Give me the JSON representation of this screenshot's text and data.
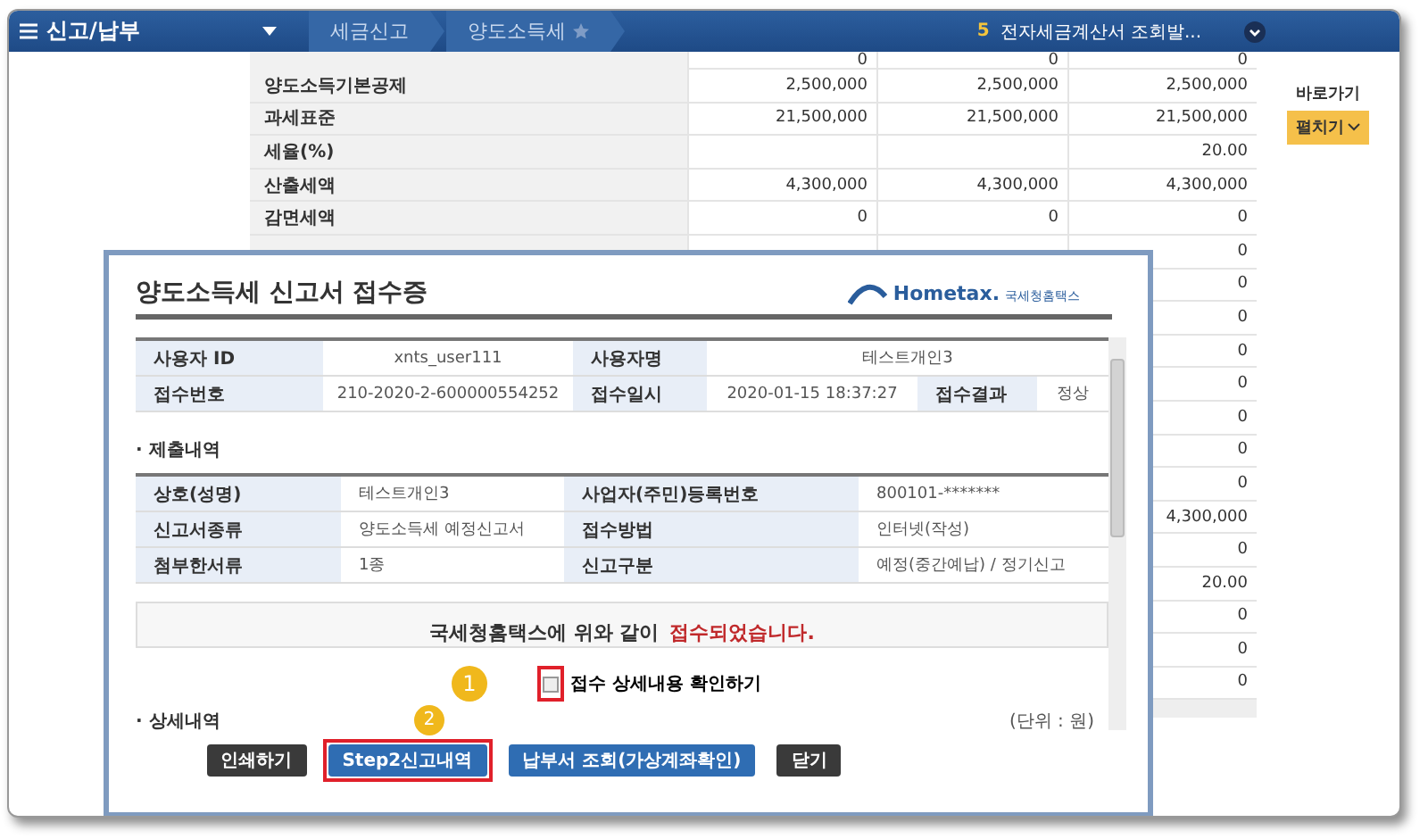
{
  "top_bar": {
    "menu_title": "신고/납부",
    "breadcrumbs": [
      {
        "label": "세금신고",
        "starred": false
      },
      {
        "label": "양도소득세",
        "starred": true
      }
    ],
    "notice_count": "5",
    "notice_text": "전자세금계산서 조회발..."
  },
  "page_table": {
    "rows": [
      {
        "values": [
          "0",
          "0",
          "0"
        ]
      },
      {
        "label": "양도소득기본공제",
        "values": [
          "2,500,000",
          "2,500,000",
          "2,500,000"
        ]
      },
      {
        "label": "과세표준",
        "values": [
          "21,500,000",
          "21,500,000",
          "21,500,000"
        ]
      },
      {
        "label": "세율(%)",
        "last_value": "20.00"
      },
      {
        "label": "산출세액",
        "values": [
          "4,300,000",
          "4,300,000",
          "4,300,000"
        ]
      },
      {
        "label": "감면세액",
        "values": [
          "0",
          "0",
          "0"
        ]
      },
      {
        "last_value": "0"
      },
      {
        "last_value": "0"
      },
      {
        "last_value": "0"
      },
      {
        "last_value": "0"
      },
      {
        "last_value": "0"
      },
      {
        "last_value": "0"
      },
      {
        "last_value": "0"
      },
      {
        "last_value": "0"
      },
      {
        "last_value": "4,300,000"
      },
      {
        "last_value": "0"
      },
      {
        "last_value": "20.00"
      },
      {
        "last_value": "0"
      },
      {
        "last_value": "0"
      },
      {
        "last_value": "0"
      }
    ]
  },
  "side_panel": {
    "shortcut_label": "바로가기",
    "expand_button": "펼치기"
  },
  "dialog": {
    "title": "양도소득세 신고서 접수증",
    "logo_text": "Hometax.",
    "logo_subtext": "국세청홈택스",
    "info_rows": [
      [
        {
          "label": "사용자 ID",
          "value": "xnts_user111"
        },
        {
          "label": "사용자명",
          "value": "테스트개인3"
        }
      ],
      [
        {
          "label": "접수번호",
          "value": "210-2020-2-600000554252"
        },
        {
          "label": "접수일시",
          "value": "2020-01-15 18:37:27"
        },
        {
          "label": "접수결과",
          "value": "정상"
        }
      ]
    ],
    "submission_heading": "· 제출내역",
    "submission_rows": [
      [
        {
          "label": "상호(성명)",
          "value": "테스트개인3"
        },
        {
          "label": "사업자(주민)등록번호",
          "value": "800101-*******"
        }
      ],
      [
        {
          "label": "신고서종류",
          "value": "양도소득세 예정신고서"
        },
        {
          "label": "접수방법",
          "value": "인터넷(작성)"
        }
      ],
      [
        {
          "label": "첨부한서류",
          "value": "1종"
        },
        {
          "label": "신고구분",
          "value": "예정(중간예납) / 정기신고"
        }
      ]
    ],
    "message_prefix": "국세청홈택스에 위와 같이",
    "message_highlight": "접수되었습니다.",
    "confirm_checkbox": {
      "label": "접수 상세내용 확인하기",
      "checked": false,
      "highlighted": true
    },
    "details_heading": "· 상세내역",
    "unit_note": "(단위 : 원)",
    "buttons": [
      {
        "label": "인쇄하기",
        "kind": "dark",
        "highlighted": false
      },
      {
        "label": "Step2신고내역",
        "kind": "primary",
        "highlighted": true
      },
      {
        "label": "납부서 조회(가상계좌확인)",
        "kind": "primary",
        "highlighted": false
      },
      {
        "label": "닫기",
        "kind": "dark",
        "highlighted": false
      }
    ]
  },
  "step_markers": [
    "1",
    "2"
  ]
}
